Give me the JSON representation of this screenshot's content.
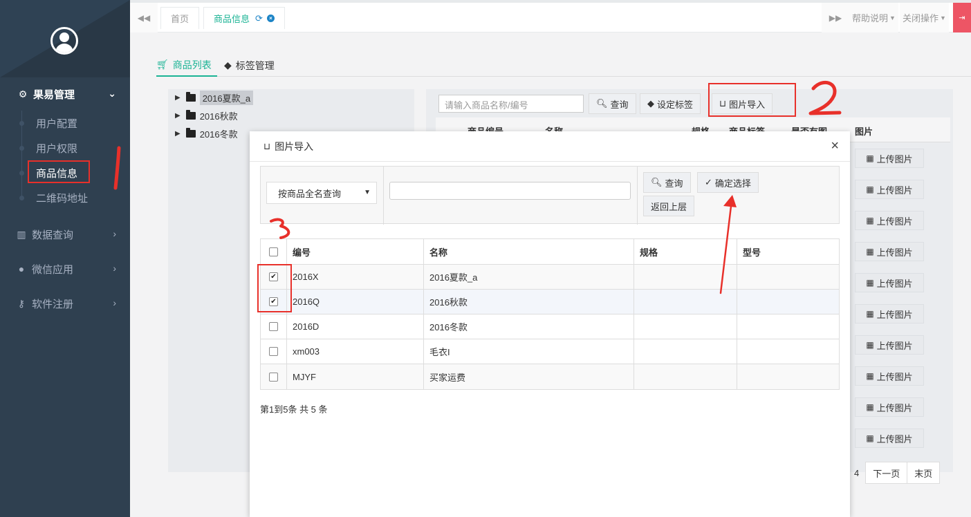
{
  "sidebar": {
    "groups": [
      {
        "label": "果易管理",
        "icon": "gears-icon"
      },
      {
        "label": "数据查询",
        "icon": "bar-chart-icon"
      },
      {
        "label": "微信应用",
        "icon": "wechat-icon"
      },
      {
        "label": "软件注册",
        "icon": "key-icon"
      }
    ],
    "sub_items": [
      {
        "label": "用户配置"
      },
      {
        "label": "用户权限"
      },
      {
        "label": "商品信息"
      },
      {
        "label": "二维码地址"
      }
    ]
  },
  "topbar": {
    "tabs": [
      {
        "label": "首页"
      },
      {
        "label": "商品信息"
      }
    ],
    "help_label": "帮助说明",
    "close_ops_label": "关闭操作"
  },
  "page": {
    "tabs": [
      {
        "label": "商品列表"
      },
      {
        "label": "标签管理"
      }
    ],
    "tree": [
      "2016夏款_a",
      "2016秋款",
      "2016冬款"
    ],
    "search_placeholder": "请输入商品名称/编号",
    "query_label": "查询",
    "set_tag_label": "设定标签",
    "image_import_label": "图片导入",
    "grid_columns": [
      "商品编号",
      "名称",
      "规格",
      "商品标签",
      "是否有图",
      "图片"
    ],
    "upload_label": "上传图片",
    "pager": [
      "4",
      "下一页",
      "末页"
    ]
  },
  "modal": {
    "title": "图片导入",
    "select_value": "按商品全名查询",
    "query_label": "查询",
    "confirm_label": "确定选择",
    "back_label": "返回上层",
    "columns": [
      "编号",
      "名称",
      "规格",
      "型号"
    ],
    "rows": [
      {
        "code": "2016X",
        "name": "2016夏款_a",
        "spec": "",
        "model": "",
        "checked": true
      },
      {
        "code": "2016Q",
        "name": "2016秋款",
        "spec": "",
        "model": "",
        "checked": true
      },
      {
        "code": "2016D",
        "name": "2016冬款",
        "spec": "",
        "model": "",
        "checked": false
      },
      {
        "code": "xm003",
        "name": "毛衣I",
        "spec": "",
        "model": "",
        "checked": false
      },
      {
        "code": "MJYF",
        "name": "买家运费",
        "spec": "",
        "model": "",
        "checked": false
      }
    ],
    "pager_info": "第1到5条 共 5 条"
  },
  "colors": {
    "sidebar_bg": "#2f4050",
    "accent": "#1ab394",
    "annotation": "#e8302a"
  }
}
